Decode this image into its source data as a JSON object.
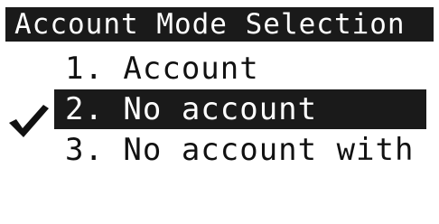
{
  "title": "Account Mode Selection",
  "menu": {
    "items": [
      {
        "label": "1. Account",
        "selected": false
      },
      {
        "label": "2. No account",
        "selected": true
      },
      {
        "label": "3. No account with ...",
        "selected": false
      }
    ],
    "selected_indicator_icon": "checkmark-icon"
  },
  "colors": {
    "background": "#ffffff",
    "highlight": "#1a1a1a",
    "highlight_text": "#ffffff",
    "text": "#111111"
  }
}
